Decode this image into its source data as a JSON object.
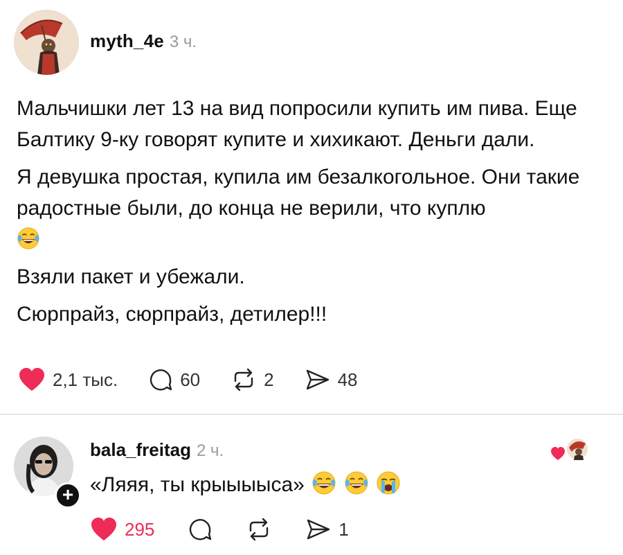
{
  "post": {
    "username": "myth_4e",
    "time": "3 ч.",
    "paragraphs": [
      "Мальчишки лет 13 на вид попросили купить им пива. Еще Балтику 9-ку говорят купите и хихикают. Деньги дали.",
      "Я девушка простая, купила им безалкогольное. Они такие радостные были, до конца не верили, что куплю",
      "Взяли пакет и убежали.",
      "Сюрпрайз, сюрпрайз, детилер!!!"
    ],
    "actions": {
      "likes": "2,1 тыс.",
      "comments": "60",
      "reposts": "2",
      "shares": "48"
    }
  },
  "reply": {
    "username": "bala_freitag",
    "time": "2 ч.",
    "text": "«Ляяя, ты крыыыыса»",
    "actions": {
      "likes": "295",
      "shares": "1"
    }
  },
  "colors": {
    "like_red": "#ef2b57",
    "text": "#111111",
    "muted": "#9a9a9a",
    "emoji_yellow": "#ffcc33"
  },
  "icons": [
    "heart-icon",
    "comment-icon",
    "repost-icon",
    "share-icon",
    "laughing-tears-emoji",
    "crying-emoji",
    "plus-icon"
  ]
}
